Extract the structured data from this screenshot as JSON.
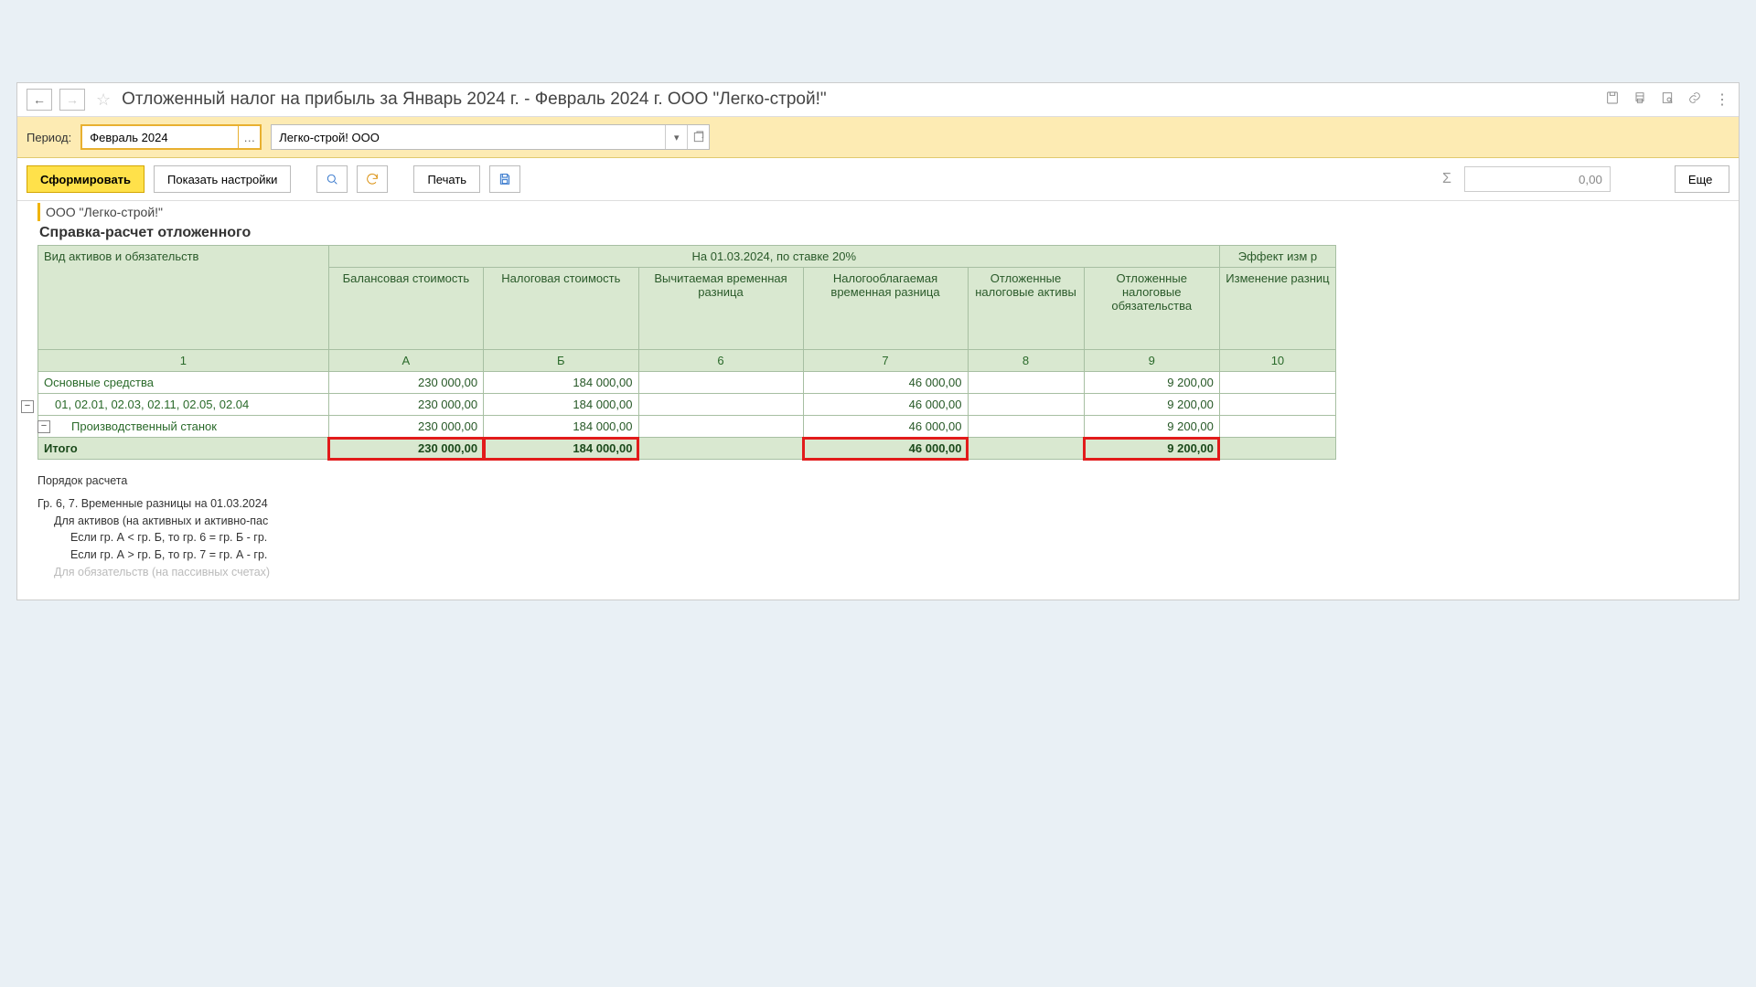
{
  "title": "Отложенный налог на прибыль за Январь 2024 г. - Февраль 2024 г. ООО \"Легко-строй!\"",
  "filter": {
    "period_label": "Период:",
    "period_value": "Февраль 2024",
    "org_value": "Легко-строй! ООО"
  },
  "actions": {
    "generate": "Сформировать",
    "settings": "Показать настройки",
    "print": "Печать",
    "more": "Еще",
    "sum_placeholder": "0,00"
  },
  "report": {
    "org_header": "ООО \"Легко-строй!\"",
    "report_title": "Справка-расчет отложенного",
    "header_group1": "На 01.03.2024, по ставке 20%",
    "header_group2": "Эффект изм р",
    "col_label": "Вид активов и обязательств",
    "cols": {
      "a": "Балансовая стоимость",
      "b": "Налоговая стоимость",
      "c6": "Вычитаемая временная разница",
      "c7": "Налогооблагаемая временная разница",
      "c8": "Отложенные налоговые активы",
      "c9": "Отложенные налоговые обязательства",
      "c10": "Изменение разниц"
    },
    "idx": {
      "c1": "1",
      "a": "А",
      "b": "Б",
      "c6": "6",
      "c7": "7",
      "c8": "8",
      "c9": "9",
      "c10": "10"
    },
    "rows": [
      {
        "label": "Основные средства",
        "a": "230 000,00",
        "b": "184 000,00",
        "c6": "",
        "c7": "46 000,00",
        "c8": "",
        "c9": "9 200,00",
        "c10": ""
      },
      {
        "label": "01, 02.01, 02.03, 02.11, 02.05, 02.04",
        "a": "230 000,00",
        "b": "184 000,00",
        "c6": "",
        "c7": "46 000,00",
        "c8": "",
        "c9": "9 200,00",
        "c10": ""
      },
      {
        "label": "Производственный станок",
        "a": "230 000,00",
        "b": "184 000,00",
        "c6": "",
        "c7": "46 000,00",
        "c8": "",
        "c9": "9 200,00",
        "c10": ""
      }
    ],
    "total": {
      "label": "Итого",
      "a": "230 000,00",
      "b": "184 000,00",
      "c6": "",
      "c7": "46 000,00",
      "c8": "",
      "c9": "9 200,00",
      "c10": ""
    }
  },
  "notes": {
    "t": "Порядок расчета",
    "l1": "Гр. 6, 7. Временные разницы на 01.03.2024",
    "l2": "Для активов (на активных и активно-пас",
    "l3": "Если гр. А < гр. Б, то гр. 6 = гр. Б - гр.",
    "l4": "Если гр. А > гр. Б, то гр. 7 = гр. А - гр.",
    "l5": "Для обязательств (на пассивных счетах)"
  }
}
